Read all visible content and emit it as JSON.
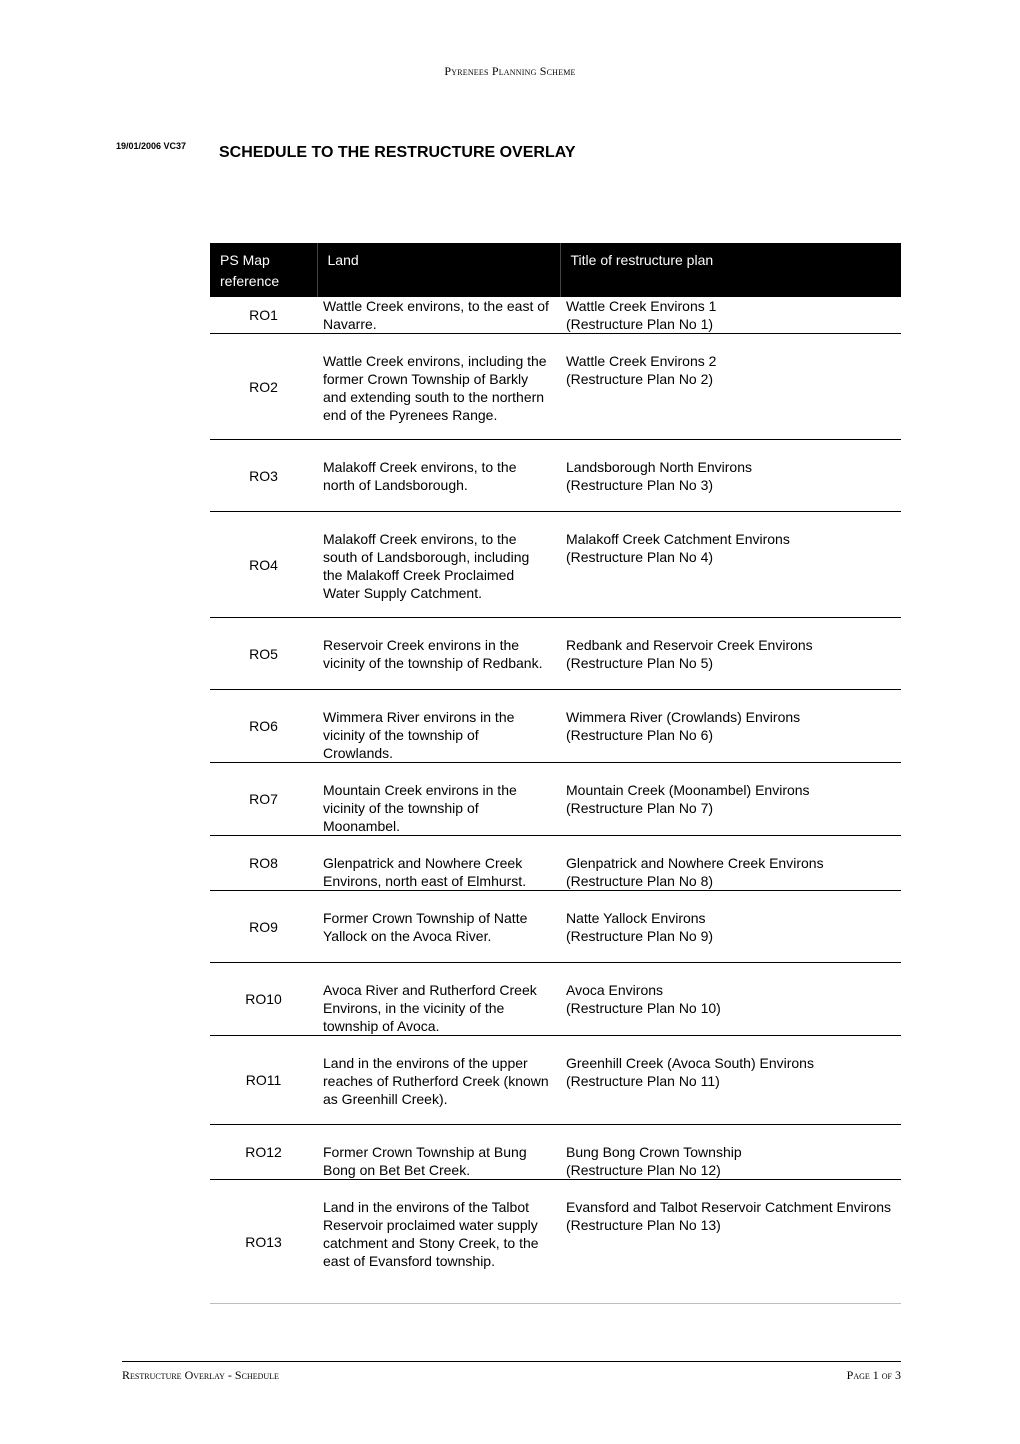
{
  "header": {
    "running_head": "Pyrenees Planning Scheme",
    "amendment": "19/01/2006 VC37",
    "title": "SCHEDULE TO THE RESTRUCTURE OVERLAY"
  },
  "table": {
    "columns": [
      "PS Map reference",
      "Land",
      "Title of restructure plan"
    ],
    "rows": [
      {
        "ref": "RO1",
        "land": "Wattle Creek environs, to the east of Navarre.",
        "title_line1": "Wattle Creek Environs 1",
        "title_line2": "(Restructure Plan No 1)"
      },
      {
        "ref": "RO2",
        "land": "Wattle Creek environs, including the former Crown Township of Barkly and extending south to the northern end of the Pyrenees Range.",
        "title_line1": "Wattle Creek Environs 2",
        "title_line2": "(Restructure Plan No 2)"
      },
      {
        "ref": "RO3",
        "land": "Malakoff Creek environs, to the north of Landsborough.",
        "title_line1": "Landsborough North Environs",
        "title_line2": "(Restructure Plan No 3)"
      },
      {
        "ref": "RO4",
        "land": "Malakoff Creek environs, to the south of Landsborough, including the Malakoff Creek Proclaimed Water Supply Catchment.",
        "title_line1": "Malakoff Creek Catchment Environs",
        "title_line2": "(Restructure Plan No 4)"
      },
      {
        "ref": "RO5",
        "land": "Reservoir Creek environs in the vicinity of the township of Redbank.",
        "title_line1": "Redbank and Reservoir Creek Environs",
        "title_line2": "(Restructure Plan No 5)"
      },
      {
        "ref": "RO6",
        "land": "Wimmera River environs in the vicinity of the township of Crowlands.",
        "title_line1": "Wimmera River (Crowlands) Environs",
        "title_line2": "(Restructure Plan No 6)"
      },
      {
        "ref": "RO7",
        "land": "Mountain Creek environs in the vicinity of the township of Moonambel.",
        "title_line1": "Mountain Creek (Moonambel) Environs",
        "title_line2": "(Restructure Plan No 7)"
      },
      {
        "ref": "RO8",
        "land": "Glenpatrick and Nowhere Creek Environs, north east of Elmhurst.",
        "title_line1": "Glenpatrick and Nowhere Creek Environs",
        "title_line2": "(Restructure Plan No 8)"
      },
      {
        "ref": "RO9",
        "land": "Former Crown Township of Natte Yallock on the Avoca River.",
        "title_line1": "Natte Yallock Environs",
        "title_line2": "(Restructure Plan No 9)"
      },
      {
        "ref": "RO10",
        "land": "Avoca River and Rutherford Creek Environs, in the vicinity of the township of Avoca.",
        "title_line1": "Avoca Environs",
        "title_line2": "(Restructure Plan No 10)"
      },
      {
        "ref": "RO11",
        "land": "Land in the environs of the upper reaches of Rutherford Creek (known as Greenhill Creek).",
        "title_line1": "Greenhill Creek (Avoca South) Environs",
        "title_line2": "(Restructure Plan No 11)"
      },
      {
        "ref": "RO12",
        "land": "Former Crown Township at Bung Bong on Bet Bet Creek.",
        "title_line1": "Bung Bong Crown Township",
        "title_line2": "(Restructure Plan No 12)"
      },
      {
        "ref": "RO13",
        "land": "Land in the environs of the Talbot Reservoir proclaimed water supply catchment and Stony Creek, to the east of Evansford township.",
        "title_line1": "Evansford and Talbot Reservoir Catchment Environs",
        "title_line2": "(Restructure Plan No 13)"
      }
    ]
  },
  "footer": {
    "left": "Restructure Overlay - Schedule",
    "right": "Page 1 of 3"
  }
}
